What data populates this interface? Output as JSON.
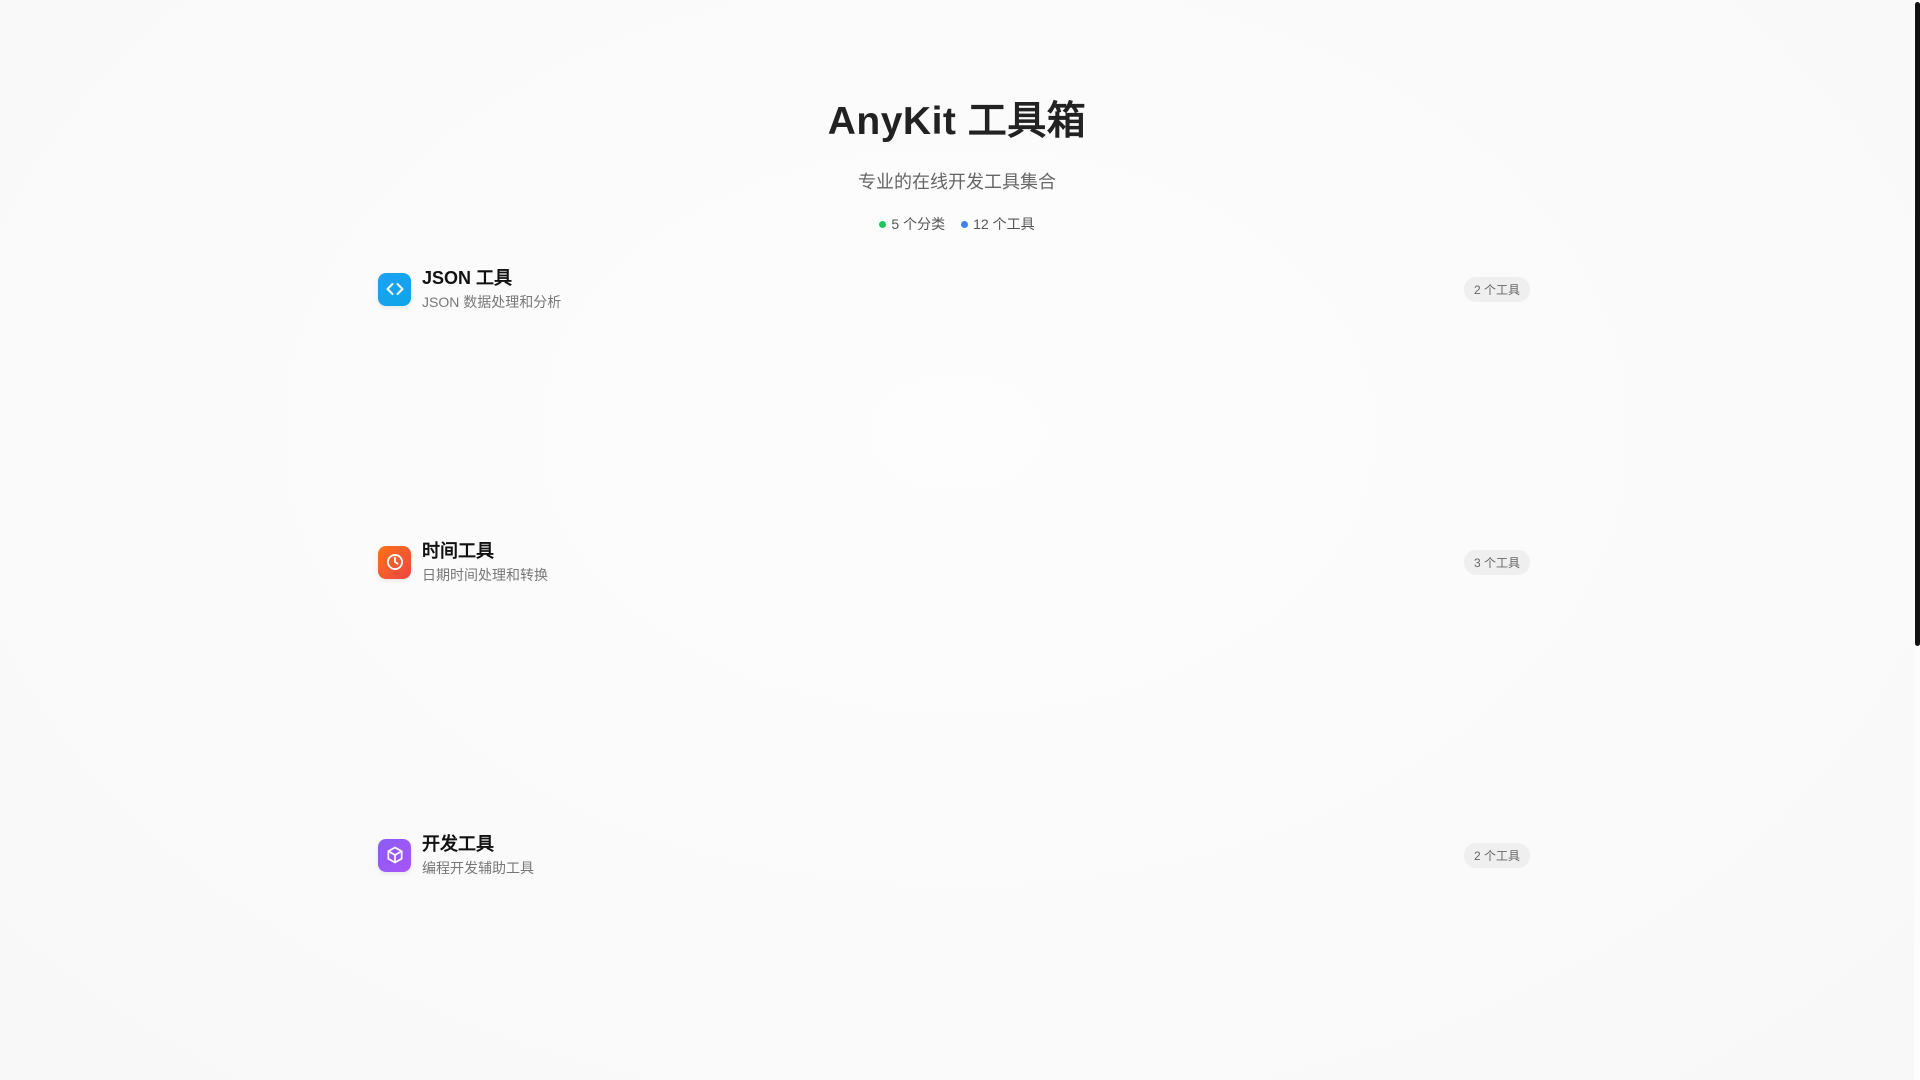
{
  "header": {
    "title": "AnyKit 工具箱",
    "subtitle": "专业的在线开发工具集合",
    "stats": [
      {
        "label": "5 个分类",
        "color": "#22c55e"
      },
      {
        "label": "12 个工具",
        "color": "#3b82f6"
      }
    ]
  },
  "categories": [
    {
      "title": "JSON 工具",
      "desc": "JSON 数据处理和分析",
      "badge": "2 个工具",
      "icon": "code-icon",
      "color_from": "#1da1f2",
      "color_to": "#0ea5e9"
    },
    {
      "title": "时间工具",
      "desc": "日期时间处理和转换",
      "badge": "3 个工具",
      "icon": "clock-icon",
      "color_from": "#f97316",
      "color_to": "#ef4444"
    },
    {
      "title": "开发工具",
      "desc": "编程开发辅助工具",
      "badge": "2 个工具",
      "icon": "cube-icon",
      "color_from": "#8b5cf6",
      "color_to": "#a855f7"
    }
  ]
}
